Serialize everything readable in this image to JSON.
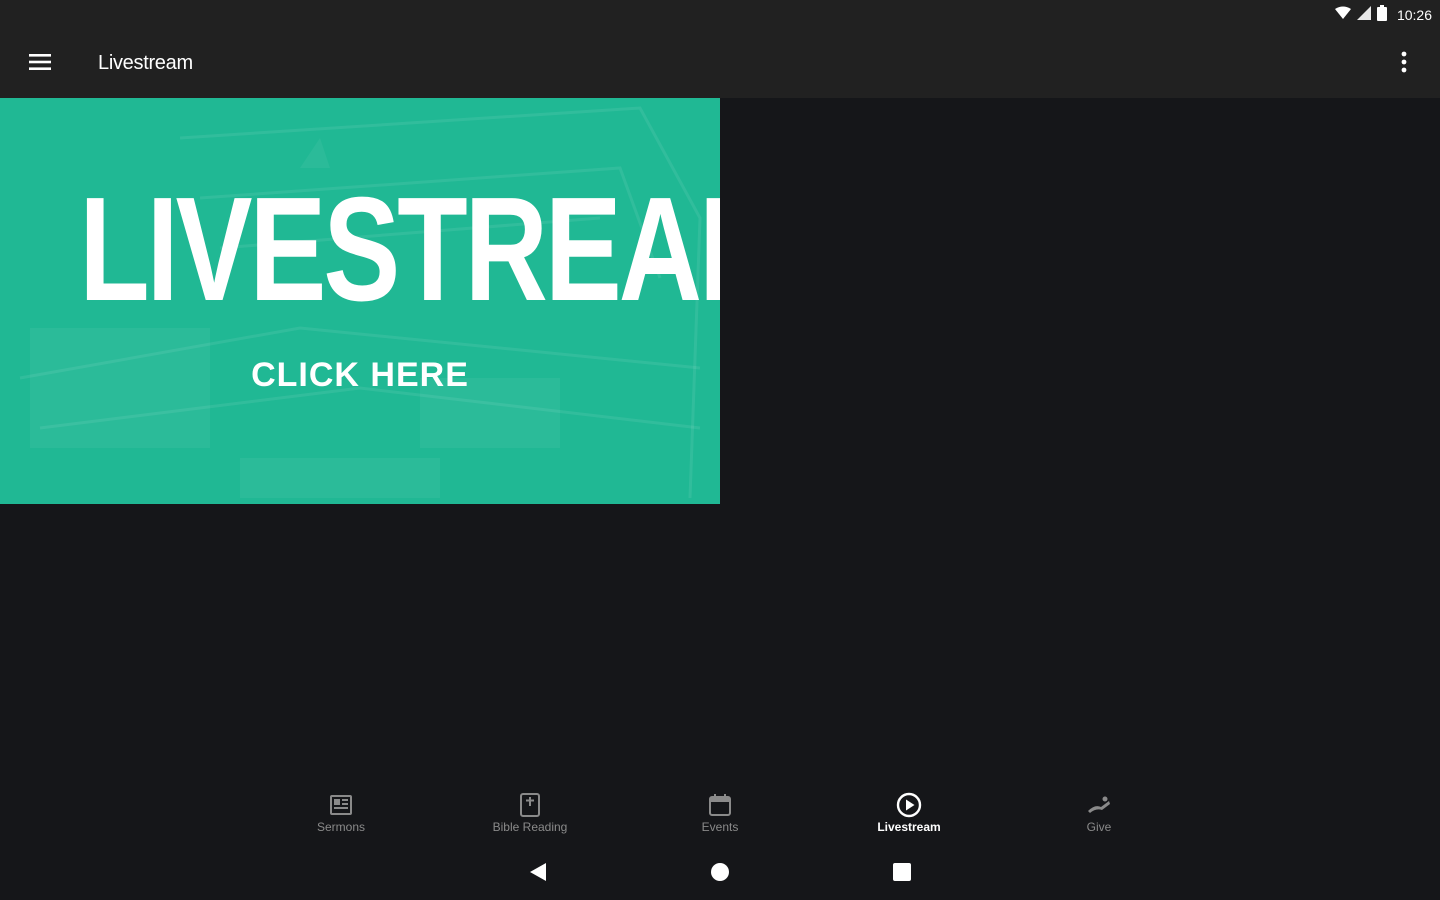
{
  "status_bar": {
    "time": "10:26"
  },
  "app_bar": {
    "title": "Livestream"
  },
  "banner": {
    "title": "LIVESTREAM",
    "cta": "CLICK HERE",
    "color": "#20b894"
  },
  "bottom_nav": {
    "items": [
      {
        "label": "Sermons",
        "icon": "sermons-icon",
        "active": false
      },
      {
        "label": "Bible Reading",
        "icon": "bible-icon",
        "active": false
      },
      {
        "label": "Events",
        "icon": "calendar-icon",
        "active": false
      },
      {
        "label": "Livestream",
        "icon": "play-circle-icon",
        "active": true
      },
      {
        "label": "Give",
        "icon": "give-icon",
        "active": false
      }
    ]
  },
  "colors": {
    "app_bar": "#212121",
    "background": "#151619",
    "accent": "#20b894"
  }
}
